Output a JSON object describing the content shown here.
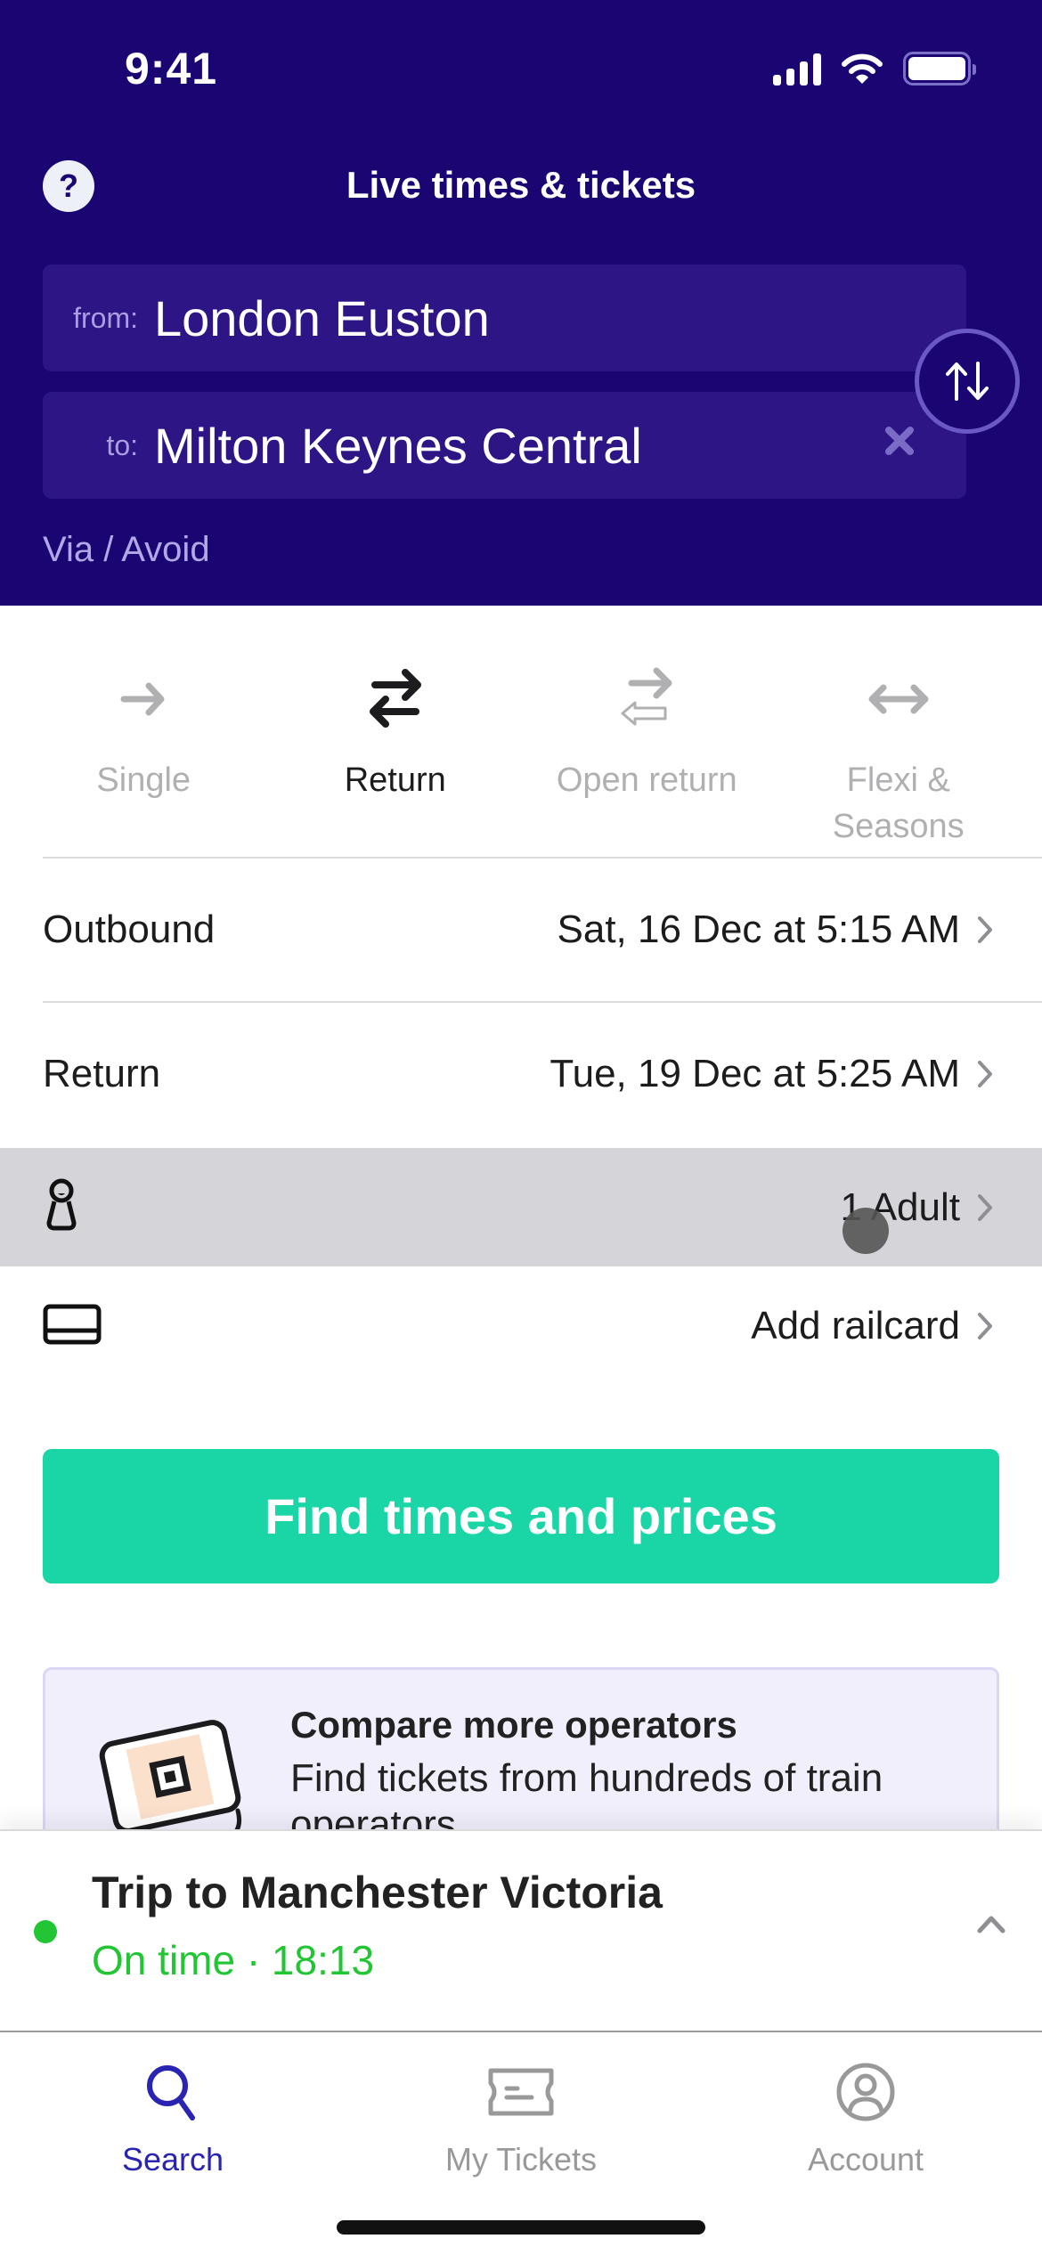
{
  "status_bar": {
    "time": "9:41"
  },
  "header": {
    "title": "Live times & tickets",
    "help_icon": "question-mark-icon",
    "from": {
      "label": "from:",
      "value": "London Euston"
    },
    "to": {
      "label": "to:",
      "value": "Milton Keynes Central",
      "clear_icon": "close-icon"
    },
    "swap_icon": "swap-vertical-icon",
    "via_avoid": "Via / Avoid"
  },
  "journey_types": {
    "selected": "Return",
    "items": [
      {
        "label": "Single",
        "icon": "arrow-right-icon"
      },
      {
        "label": "Return",
        "icon": "return-arrows-icon"
      },
      {
        "label": "Open return",
        "icon": "open-return-arrows-icon"
      },
      {
        "label": "Flexi & Seasons",
        "icon": "double-arrow-icon"
      }
    ]
  },
  "outbound": {
    "label": "Outbound",
    "value": "Sat, 16 Dec at 5:15 AM"
  },
  "return": {
    "label": "Return",
    "value": "Tue, 19 Dec at 5:25 AM"
  },
  "passengers": {
    "value": "1 Adult",
    "icon": "person-icon"
  },
  "railcard": {
    "value": "Add railcard",
    "icon": "railcard-icon"
  },
  "find_button": "Find times and prices",
  "promo": {
    "title": "Compare more operators",
    "body": "Find tickets from hundreds of train operators"
  },
  "trip": {
    "title": "Trip to Manchester Victoria",
    "status": "On time · 18:13",
    "status_color": "#22c533"
  },
  "tabs": [
    {
      "label": "Search",
      "icon": "search-icon",
      "active": true
    },
    {
      "label": "My Tickets",
      "icon": "ticket-icon",
      "active": false
    },
    {
      "label": "Account",
      "icon": "account-icon",
      "active": false
    }
  ],
  "colors": {
    "brand": "#1a0573",
    "field_bg": "#2e1585",
    "accent_button": "#1ad6a6",
    "tab_active": "#2a24b2"
  }
}
